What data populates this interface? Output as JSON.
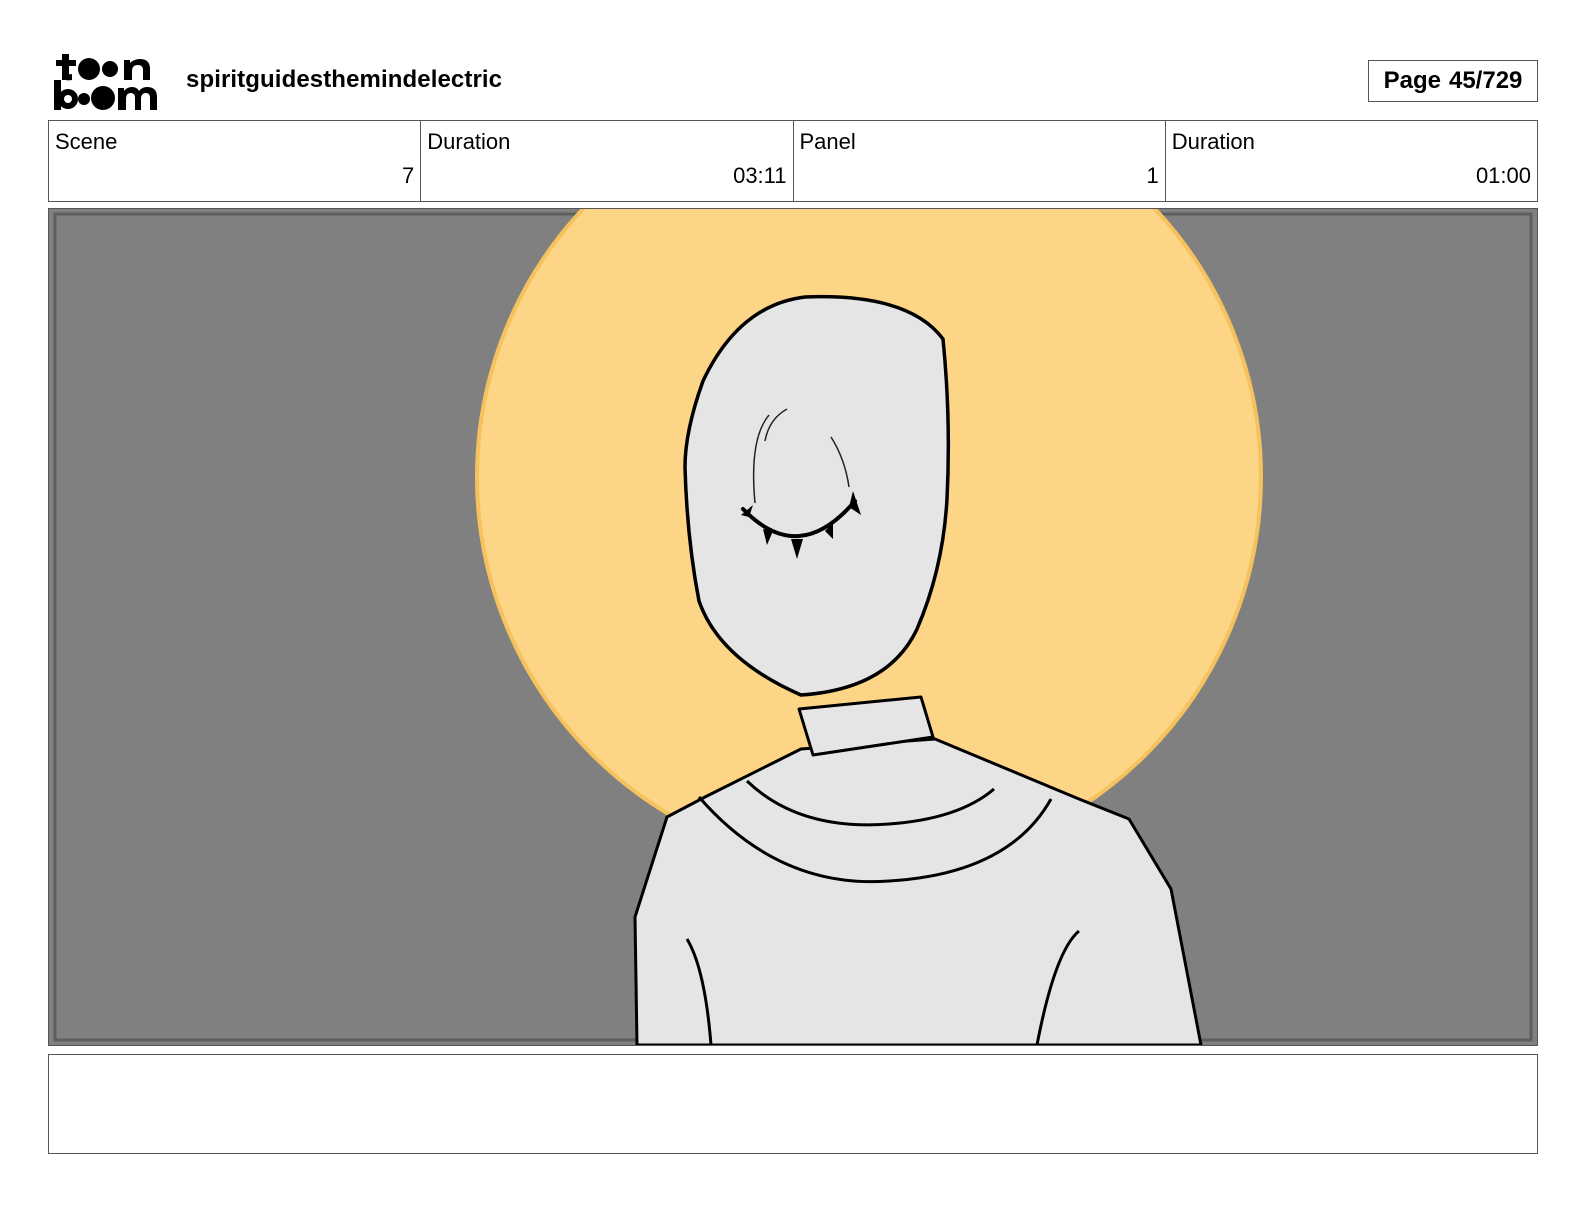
{
  "header": {
    "logo_text": "toon boom",
    "title": "spiritguidesthemindelectric",
    "page_label": "Page",
    "page_number": "45/729"
  },
  "info": {
    "scene_label": "Scene",
    "scene_value": "7",
    "scene_duration_label": "Duration",
    "scene_duration_value": "03:11",
    "panel_label": "Panel",
    "panel_value": "1",
    "panel_duration_label": "Duration",
    "panel_duration_value": "01:00"
  },
  "panel": {
    "background_color": "#808080",
    "halo_color": "#fdd586",
    "figure_fill": "#e5e5e5",
    "line_color": "#000000"
  },
  "notes": {
    "text": ""
  }
}
